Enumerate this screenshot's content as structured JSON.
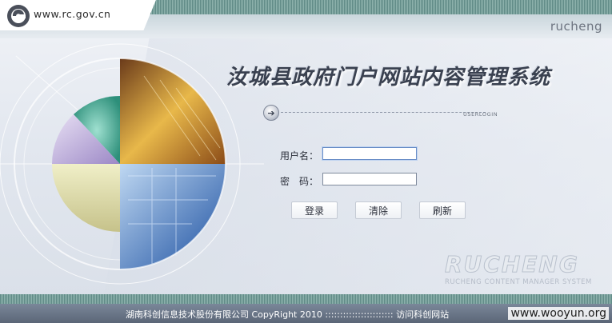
{
  "header": {
    "site_url": "www.rc.gov.cn",
    "brand": "rucheng"
  },
  "title": "汝城县政府门户网站内容管理系统",
  "login": {
    "section_label": "USERLOGIN",
    "username_label": "用户名：",
    "username_value": "",
    "password_label": "密　码：",
    "password_value": "",
    "login_button": "登录",
    "clear_button": "清除",
    "refresh_button": "刷新"
  },
  "watermark": {
    "big": "RUCHENG",
    "sub": "RUCHENG CONTENT MANAGER SYSTEM"
  },
  "footer": {
    "copyright": "湖南科创信息技术股份有限公司 CopyRight 2010 ::::::::::::::::::::::: ",
    "link": "访问科创网站",
    "site_mark": "www.wooyun.org"
  },
  "colors": {
    "stripe": "#8fb3ae",
    "footer_bg": "#5b6677",
    "title": "#3a4150"
  },
  "icons": {
    "logo": "rc-logo-icon",
    "arrow": "arrow-right-circle-icon"
  }
}
